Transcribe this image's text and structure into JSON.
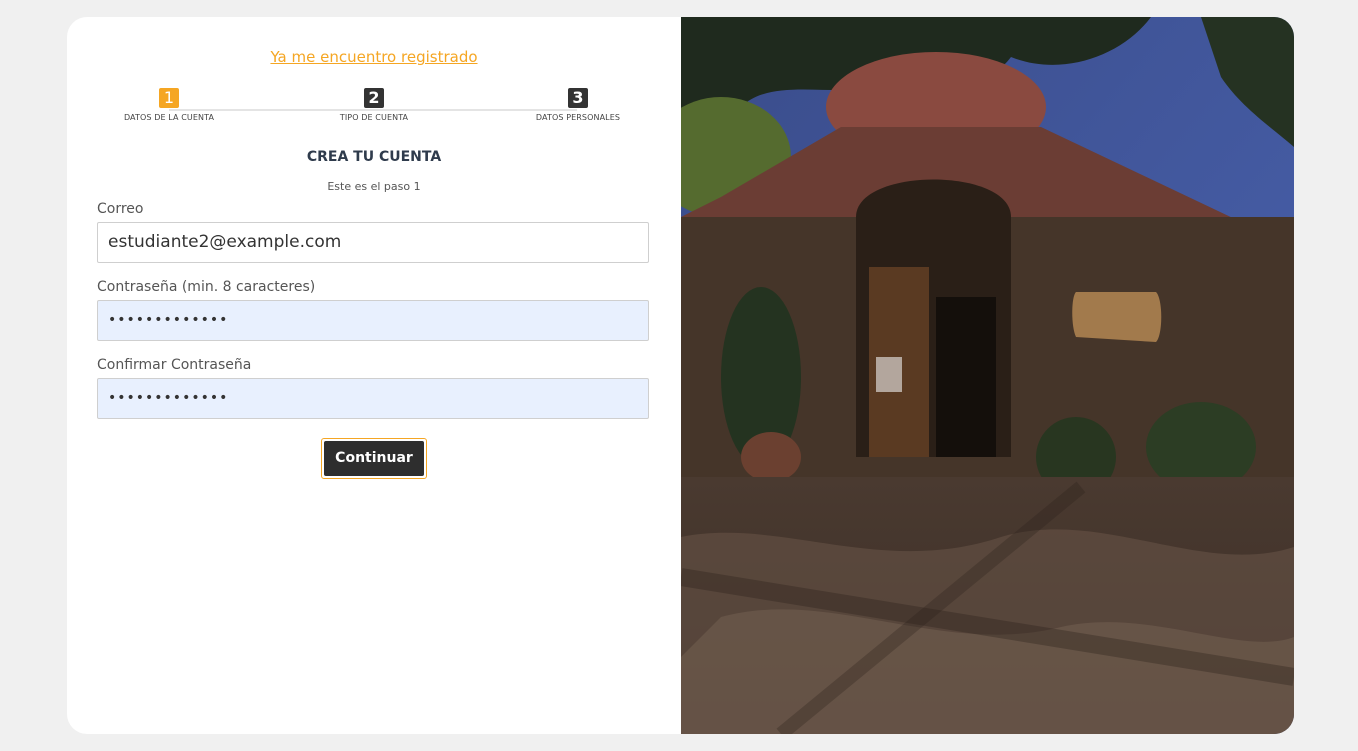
{
  "form": {
    "login_link": "Ya me encuentro registrado",
    "steps": [
      {
        "number": "1",
        "label": "DATOS DE LA CUENTA",
        "active": true
      },
      {
        "number": "2",
        "label": "TIPO DE CUENTA",
        "active": false
      },
      {
        "number": "3",
        "label": "DATOS PERSONALES",
        "active": false
      }
    ],
    "title": "CREA TU CUENTA",
    "subtitle": "Este es el paso 1",
    "email": {
      "label": "Correo",
      "value": "estudiante2@example.com"
    },
    "password": {
      "label": "Contraseña (min. 8 caracteres)",
      "value": "•••••••••••••"
    },
    "confirm_password": {
      "label": "Confirmar Contraseña",
      "value": "•••••••••••••"
    },
    "continue_label": "Continuar"
  },
  "colors": {
    "accent": "#f5a623",
    "dark": "#2e2e2e",
    "autofill": "#e8f0fe",
    "background": "#f0f0f0"
  }
}
